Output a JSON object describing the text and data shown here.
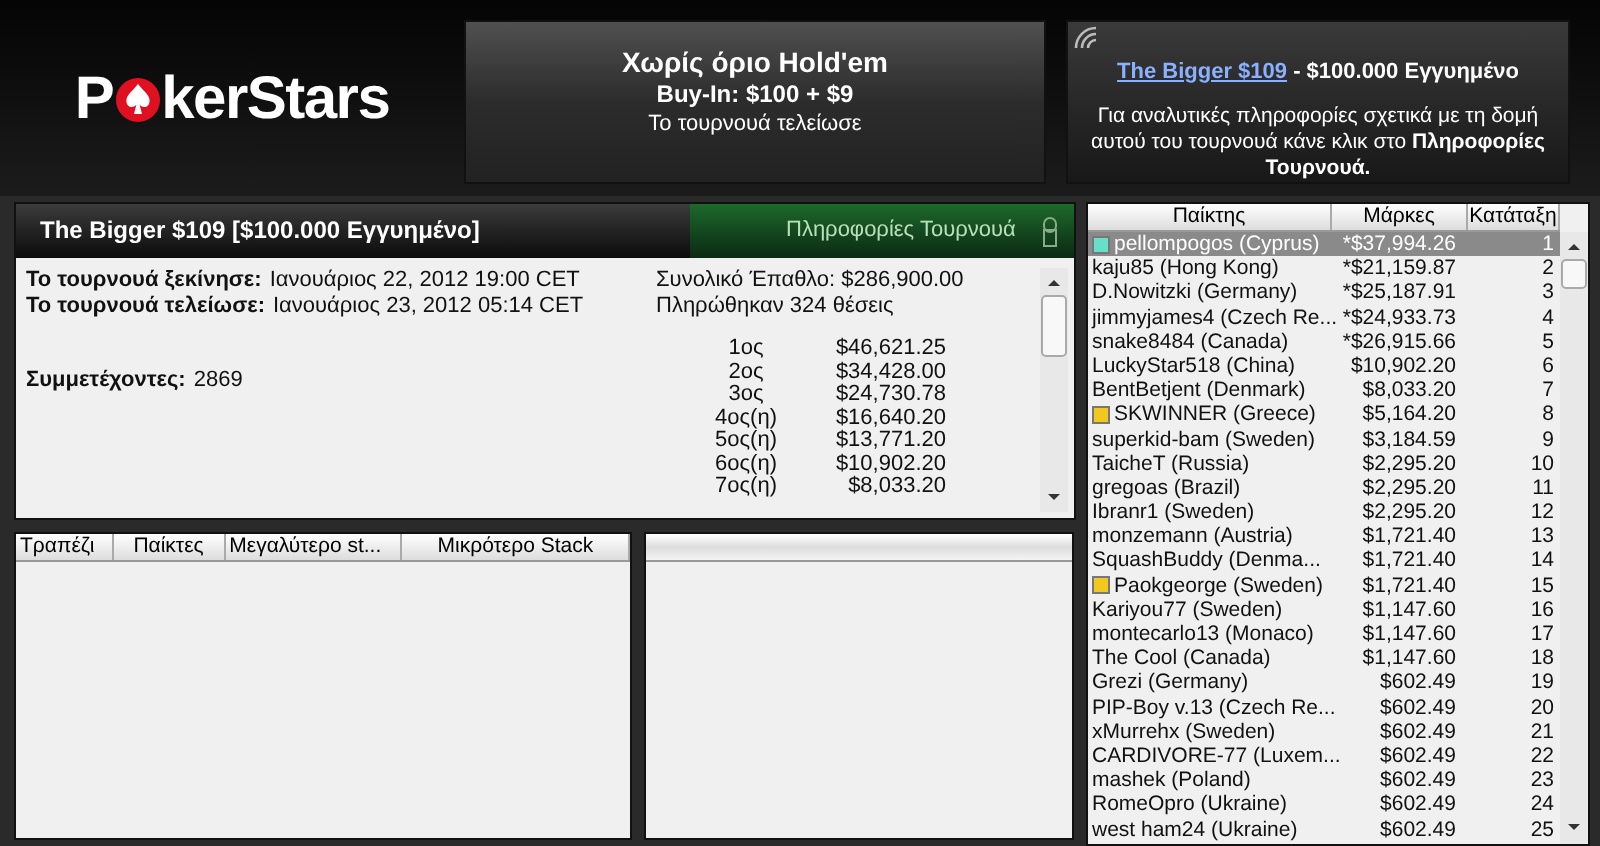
{
  "logo": {
    "before": "P",
    "after": "kerStars"
  },
  "game_box": {
    "title": "Χωρίς όριο Hold'em",
    "buy_in": "Buy-In: $100 + $9",
    "status": "Το τουρνουά τελείωσε"
  },
  "info_box": {
    "link": "The Bigger $109",
    "headline": " - $100.000 Εγγυημένο",
    "text": "Για αναλυτικές πληροφορίες σχετικά με τη δομή αυτού του τουρνουά κάνε κλικ στο **Πληροφορίες Τουρνουά.**"
  },
  "tournament": {
    "title": "The Bigger $109 [$100.000 Εγγυημένο]",
    "tab": "Πληροφορίες Τουρνουά",
    "details": [
      {
        "label": "Το τουρνουά ξεκίνησε:",
        "value": "Ιανουάριος 22, 2012 19:00 CET"
      },
      {
        "label": "Το τουρνουά τελείωσε:",
        "value": "Ιανουάριος 23, 2012 05:14 CET"
      }
    ],
    "entrants": {
      "label": "Συμμετέχοντες:",
      "value": "2869"
    },
    "prize_pool": "Συνολικό Έπαθλο: $286,900.00",
    "paid": "Πληρώθηκαν 324 θέσεις",
    "payouts": [
      {
        "place": "1ος",
        "amount": "$46,621.25"
      },
      {
        "place": "2ος",
        "amount": "$34,428.00"
      },
      {
        "place": "3ος",
        "amount": "$24,730.78"
      },
      {
        "place": "4ος(η)",
        "amount": "$16,640.20"
      },
      {
        "place": "5ος(η)",
        "amount": "$13,771.20"
      },
      {
        "place": "6ος(η)",
        "amount": "$10,902.20"
      },
      {
        "place": "7ος(η)",
        "amount": "$8,033.20"
      }
    ]
  },
  "tables": {
    "columns": [
      "Τραπέζι",
      "Παίκτες",
      "Μεγαλύτερο st...",
      "Μικρότερο Stack"
    ]
  },
  "players": {
    "columns": [
      "Παίκτης",
      "Μάρκες",
      "Κατάταξη"
    ],
    "rows": [
      {
        "name": "pellompogos (Cyprus)",
        "chips": "*$37,994.26",
        "rank": "1",
        "selected": true,
        "color": "#66e0c8"
      },
      {
        "name": "kaju85 (Hong Kong)",
        "chips": "*$21,159.87",
        "rank": "2",
        "selected": false
      },
      {
        "name": "D.Nowitzki (Germany)",
        "chips": "*$25,187.91",
        "rank": "3",
        "selected": false
      },
      {
        "name": "jimmyjames4 (Czech Re...",
        "chips": "*$24,933.73",
        "rank": "4",
        "selected": false
      },
      {
        "name": "snake8484 (Canada)",
        "chips": "*$26,915.66",
        "rank": "5",
        "selected": false
      },
      {
        "name": "LuckyStar518 (China)",
        "chips": "$10,902.20",
        "rank": "6",
        "selected": false
      },
      {
        "name": "BentBetjent (Denmark)",
        "chips": "$8,033.20",
        "rank": "7",
        "selected": false
      },
      {
        "name": "SKWINNER (Greece)",
        "chips": "$5,164.20",
        "rank": "8",
        "selected": false,
        "color": "#f2c81e"
      },
      {
        "name": "superkid-bam (Sweden)",
        "chips": "$3,184.59",
        "rank": "9",
        "selected": false
      },
      {
        "name": "TaicheT (Russia)",
        "chips": "$2,295.20",
        "rank": "10",
        "selected": false
      },
      {
        "name": "gregoas (Brazil)",
        "chips": "$2,295.20",
        "rank": "11",
        "selected": false
      },
      {
        "name": "Ibranr1 (Sweden)",
        "chips": "$2,295.20",
        "rank": "12",
        "selected": false
      },
      {
        "name": "monzemann (Austria)",
        "chips": "$1,721.40",
        "rank": "13",
        "selected": false
      },
      {
        "name": "SquashBuddy (Denma...",
        "chips": "$1,721.40",
        "rank": "14",
        "selected": false
      },
      {
        "name": "Paokgeorge (Sweden)",
        "chips": "$1,721.40",
        "rank": "15",
        "selected": false,
        "color": "#f2c81e"
      },
      {
        "name": "Kariyou77 (Sweden)",
        "chips": "$1,147.60",
        "rank": "16",
        "selected": false
      },
      {
        "name": "montecarlo13 (Monaco)",
        "chips": "$1,147.60",
        "rank": "17",
        "selected": false
      },
      {
        "name": "The Cool (Canada)",
        "chips": "$1,147.60",
        "rank": "18",
        "selected": false
      },
      {
        "name": "Grezi (Germany)",
        "chips": "$602.49",
        "rank": "19",
        "selected": false
      },
      {
        "name": "PIP-Boy v.13 (Czech Re...",
        "chips": "$602.49",
        "rank": "20",
        "selected": false
      },
      {
        "name": "xMurrehx (Sweden)",
        "chips": "$602.49",
        "rank": "21",
        "selected": false
      },
      {
        "name": "CARDIVORE-77 (Luxem...",
        "chips": "$602.49",
        "rank": "22",
        "selected": false
      },
      {
        "name": "mashek (Poland)",
        "chips": "$602.49",
        "rank": "23",
        "selected": false
      },
      {
        "name": "RomeOpro (Ukraine)",
        "chips": "$602.49",
        "rank": "24",
        "selected": false
      },
      {
        "name": "west ham24 (Ukraine)",
        "chips": "$602.49",
        "rank": "25",
        "selected": false
      }
    ]
  }
}
